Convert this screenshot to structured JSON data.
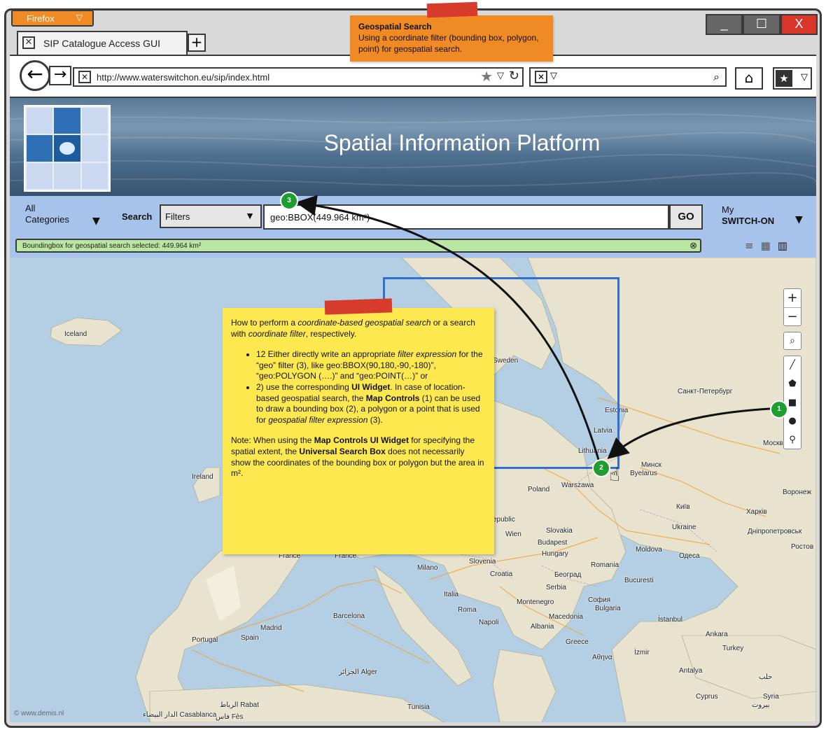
{
  "browser": {
    "menu_button": "Firefox",
    "tab_title": "SIP Catalogue Access GUI",
    "new_tab_symbol": "+",
    "url": "http://www.waterswitchon.eu/sip/index.html",
    "window_controls": [
      "_",
      "☐",
      "X"
    ]
  },
  "callout": {
    "title": "Geospatial Search",
    "body": "Using a coordinate filter (bounding box, polygon, point) for geospatial search."
  },
  "app": {
    "banner_title": "Spatial Information Platform",
    "categories_line1": "All",
    "categories_line2": "Categories",
    "search_label": "Search",
    "filter_select_value": "Filters",
    "query_value": "geo:BBOX(449.964 km²)",
    "go_label": "GO",
    "account_line1": "My",
    "account_line2": "SWITCH-ON",
    "status_message": "Boundingbox for geospatial search selected: 449.964 km²"
  },
  "map_controls": {
    "zoom_in": "+",
    "zoom_out": "−"
  },
  "markers": [
    "1",
    "2",
    "3"
  ],
  "sticky_note": {
    "intro_pre": "How to perform a ",
    "intro_em1": "coordinate-based geospatial search",
    "intro_mid": " or a search with ",
    "intro_em2": "coordinate filter",
    "intro_post": ", respectively.",
    "item1_pre": "12 Either directly write an appropriate ",
    "item1_em": "filter expression",
    "item1_post": " for the “geo” filter (3), like geo:BBOX(90,180,-90,-180)”, “geo:POLYGON (….)” and “geo:POINT(…)” or",
    "item2_pre": "2) use the corresponding ",
    "item2_b1": " UI Widget",
    "item2_mid": ". In case of location-based geospatial search, the ",
    "item2_b2": "Map Controls",
    "item2_mid2": " (1) can be used to draw a bounding box (2), a polygon or a point that is used for ",
    "item2_em": "geospatial filter expression",
    "item2_post": " (3).",
    "note_pre": "Note: When using the ",
    "note_b1": "Map Controls UI Widget",
    "note_mid": " for specifying the spatial extent, the ",
    "note_b2": "Universal Search Box",
    "note_post": " does not necessarily show the coordinates of the bounding box or polygon but the area in m²."
  },
  "map_labels": {
    "iceland": "Iceland",
    "sweden": "Sweden",
    "spb": "Санкт-Петербург",
    "estonia": "Estonia",
    "latvia": "Latvia",
    "lithuania": "Lithuania",
    "moscow": "Москва",
    "minsk": "Минск",
    "belarus": "Byelarus",
    "ireland": "Ireland",
    "poland": "Poland",
    "warsaw": "Warszawa",
    "voronezh": "Воронеж",
    "kyiv": "Київ",
    "kharkiv": "Харків",
    "ukraine": "Ukraine",
    "dnipro": "Дніпропетровськ",
    "rostov": "Ростов",
    "republic": "epublic",
    "slovakia": "Slovakia",
    "wien": "Wien",
    "budapest": "Budapest",
    "hungary": "Hungary",
    "moldova": "Moldova",
    "odesa": "Одеса",
    "france1": "France",
    "france2": "France",
    "milano": "Milano",
    "slovenia": "Slovenia",
    "croatia": "Croatia",
    "romania": "Romania",
    "beograd": "Београд",
    "bucuresti": "Bucuresti",
    "serbia": "Serbia",
    "italia": "Italia",
    "montenegro": "Montenegro",
    "sofia": "София",
    "bulgaria": "Bulgaria",
    "roma": "Roma",
    "barcelona": "Barcelona",
    "napoli": "Napoli",
    "macedonia": "Macedonia",
    "albania": "Albania",
    "istanbul": "İstanbul",
    "madrid": "Madrid",
    "portugal": "Portugal",
    "spain": "Spain",
    "ankara": "Ankara",
    "greece": "Greece",
    "izmir": "İzmir",
    "turkey": "Turkey",
    "athens": "Αθηνα",
    "algiers": "الجزائر Alger",
    "antalya": "Antalya",
    "aleppo": "حلب",
    "rabat": "الرباط Rabat",
    "casablanca": "الدار البيضاء Casablanca",
    "fes": "فاس Fès",
    "tunisia": "Tunisia",
    "cyprus": "Cyprus",
    "syria": "Syria",
    "beirut": "بيروت"
  },
  "footer": {
    "copyright": "© www.demis.nl"
  },
  "colors": {
    "firefox_orange": "#f08a24",
    "banner_title_text": "#ffffff",
    "toolbar_bg": "#a7c3ec",
    "status_green": "#b9e7a3",
    "bbox_blue": "#2e6fd6",
    "sticky_yellow": "#fde84f",
    "marker_green": "#1f9e2f",
    "tape_red": "#d63b2b"
  }
}
